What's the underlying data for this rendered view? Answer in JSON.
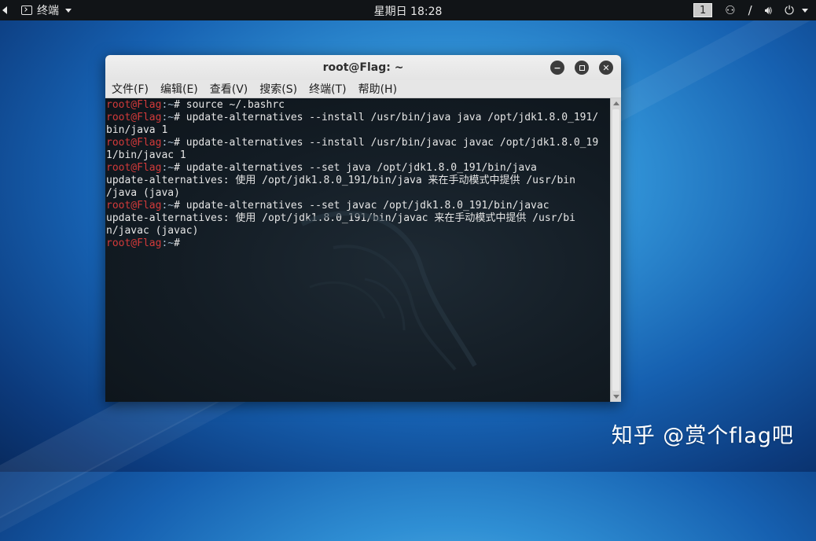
{
  "topbar": {
    "app_menu_label": "终端",
    "clock": "星期日 18:28",
    "workspace_number": "1"
  },
  "window": {
    "title": "root@Flag: ~",
    "menu": [
      "文件(F)",
      "编辑(E)",
      "查看(V)",
      "搜索(S)",
      "终端(T)",
      "帮助(H)"
    ]
  },
  "terminal": {
    "lines": [
      {
        "user": "root@Flag",
        "path": ":~",
        "cmd": "# source ~/.bashrc"
      },
      {
        "user": "root@Flag",
        "path": ":~",
        "cmd": "# update-alternatives --install /usr/bin/java java /opt/jdk1.8.0_191/"
      },
      {
        "user": "",
        "path": "",
        "cmd": "bin/java 1"
      },
      {
        "user": "root@Flag",
        "path": ":~",
        "cmd": "# update-alternatives --install /usr/bin/javac javac /opt/jdk1.8.0_19"
      },
      {
        "user": "",
        "path": "",
        "cmd": "1/bin/javac 1"
      },
      {
        "user": "root@Flag",
        "path": ":~",
        "cmd": "# update-alternatives --set java /opt/jdk1.8.0_191/bin/java"
      },
      {
        "user": "",
        "path": "",
        "cmd": "update-alternatives: 使用 /opt/jdk1.8.0_191/bin/java 来在手动模式中提供 /usr/bin"
      },
      {
        "user": "",
        "path": "",
        "cmd": "/java (java)"
      },
      {
        "user": "root@Flag",
        "path": ":~",
        "cmd": "# update-alternatives --set javac /opt/jdk1.8.0_191/bin/javac"
      },
      {
        "user": "",
        "path": "",
        "cmd": "update-alternatives: 使用 /opt/jdk1.8.0_191/bin/javac 来在手动模式中提供 /usr/bi"
      },
      {
        "user": "",
        "path": "",
        "cmd": "n/javac (javac)"
      },
      {
        "user": "root@Flag",
        "path": ":~",
        "cmd": "# "
      }
    ]
  },
  "watermark": "知乎 @赏个flag吧",
  "colors": {
    "prompt_user": "#d23a3a",
    "terminal_bg": "#131c24",
    "panel_bg": "#111417"
  }
}
